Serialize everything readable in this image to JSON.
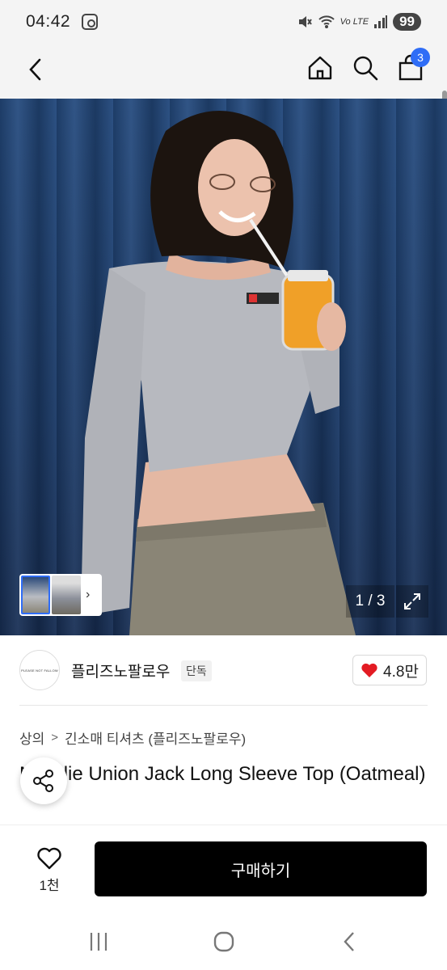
{
  "status_bar": {
    "time": "04:42",
    "network_label": "Vo LTE",
    "battery": "99"
  },
  "header": {
    "icons": [
      "back-arrow-icon",
      "home-icon",
      "search-icon",
      "shopping-bag-icon"
    ],
    "cart_count": "3"
  },
  "gallery": {
    "pager": "1 / 3",
    "thumb_chevron": "›"
  },
  "brand": {
    "logo_text": "PLEASE NOT FALLOW",
    "name": "플리즈노팔로우",
    "tag": "단독",
    "likes": "4.8만"
  },
  "breadcrumb": {
    "category": "상의",
    "separator": ">",
    "subcategory": "긴소매 티셔츠 (플리즈노팔로우)"
  },
  "product": {
    "title": "Maddie Union Jack Long Sleeve Top (Oatmeal)"
  },
  "bottom_bar": {
    "wish_count": "1천",
    "buy_label": "구매하기"
  },
  "colors": {
    "accent": "#2f6df6",
    "heart": "#e31b23",
    "buy_button": "#000000"
  }
}
